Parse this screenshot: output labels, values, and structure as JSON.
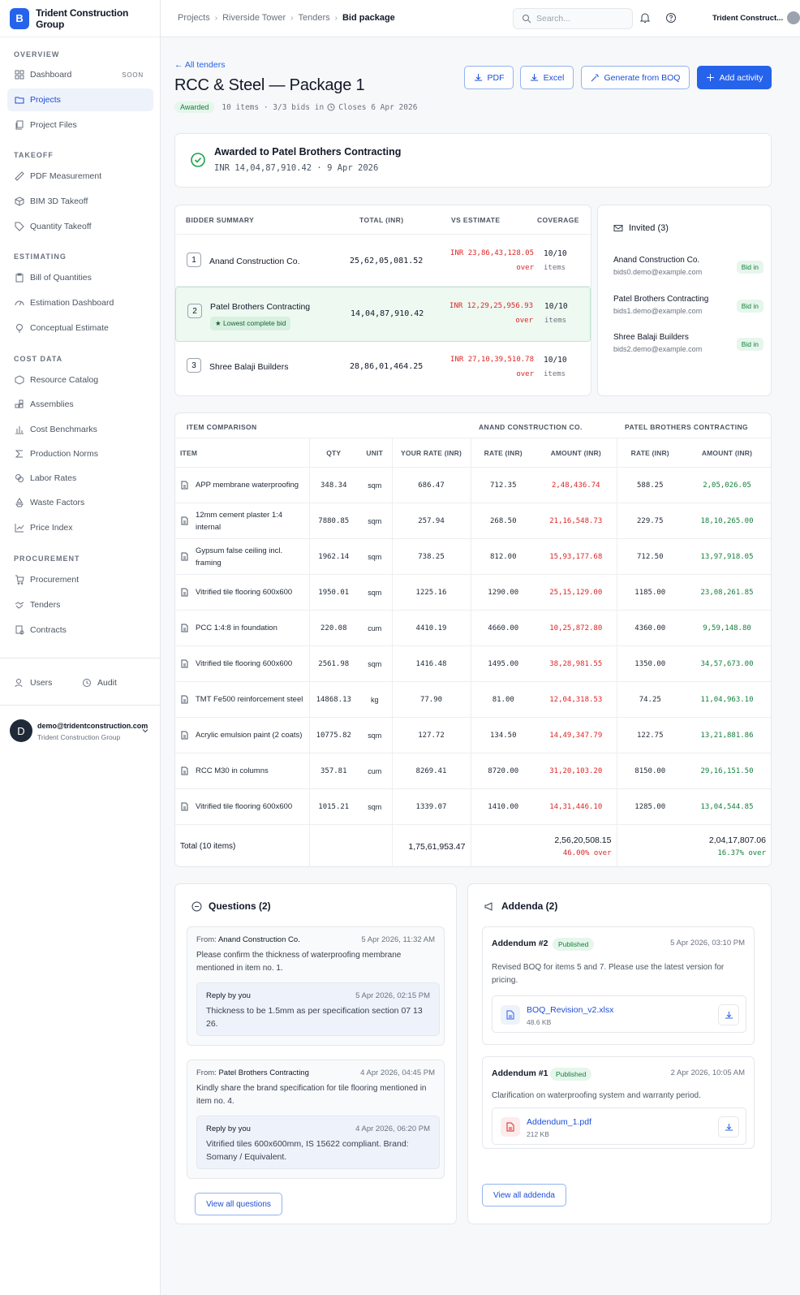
{
  "app": {
    "org": "Trident Construction Group",
    "logo_letter": "B"
  },
  "sidebar": {
    "sections": [
      "OVERVIEW",
      "TAKEOFF",
      "ESTIMATING",
      "COST DATA",
      "PROCUREMENT"
    ],
    "items": [
      {
        "label": "Dashboard",
        "icon": "grid-icon",
        "badge": "SOON"
      },
      {
        "label": "Projects",
        "icon": "folder-icon",
        "active": true
      },
      {
        "label": "Project Files",
        "icon": "files-icon"
      },
      {
        "label": "PDF Measurement",
        "icon": "ruler-icon"
      },
      {
        "label": "BIM 3D Takeoff",
        "icon": "cube-icon"
      },
      {
        "label": "Quantity Takeoff",
        "icon": "tag-icon"
      },
      {
        "label": "Bill of Quantities",
        "icon": "clipboard-icon"
      },
      {
        "label": "Estimation Dashboard",
        "icon": "gauge-icon"
      },
      {
        "label": "Conceptual Estimate",
        "icon": "bulb-icon"
      },
      {
        "label": "Resource Catalog",
        "icon": "box-icon"
      },
      {
        "label": "Assemblies",
        "icon": "blocks-icon"
      },
      {
        "label": "Cost Benchmarks",
        "icon": "bar-chart-icon"
      },
      {
        "label": "Production Norms",
        "icon": "sigma-icon"
      },
      {
        "label": "Labor Rates",
        "icon": "coins-icon"
      },
      {
        "label": "Waste Factors",
        "icon": "recycle-icon"
      },
      {
        "label": "Price Index",
        "icon": "line-chart-icon"
      },
      {
        "label": "Procurement",
        "icon": "cart-icon"
      },
      {
        "label": "Tenders",
        "icon": "handshake-icon"
      },
      {
        "label": "Contracts",
        "icon": "contract-icon"
      }
    ],
    "users": "Users",
    "audit": "Audit",
    "account": {
      "avatar": "D",
      "email": "demo@tridentconstruction.com",
      "org": "Trident Construction Group"
    }
  },
  "topbar": {
    "crumbs": [
      "Projects",
      "Riverside Tower",
      "Tenders",
      "Bid package"
    ],
    "search_placeholder": "Search...",
    "org_short": "Trident Construct..."
  },
  "header": {
    "back": "← All tenders",
    "title": "RCC & Steel — Package 1",
    "status": "Awarded",
    "meta": "10 items · 3/3 bids in",
    "closes": "Closes 6 Apr 2026",
    "buttons": {
      "pdf": "PDF",
      "excel": "Excel",
      "boq": "Generate from BOQ",
      "add": "Add activity"
    }
  },
  "award": {
    "title": "Awarded to Patel Brothers Contracting",
    "sub": "INR 14,04,87,910.42 · 9 Apr 2026"
  },
  "bidders": {
    "headers": [
      "BIDDER SUMMARY",
      "TOTAL (INR)",
      "VS ESTIMATE",
      "COVERAGE"
    ],
    "rows": [
      {
        "rank": "1",
        "name": "Anand Construction Co.",
        "total": "25,62,05,081.52",
        "vs": "INR 23,86,43,128.05",
        "vs2": "over",
        "cov": "10/10",
        "cov2": "items"
      },
      {
        "rank": "2",
        "name": "Patel Brothers Contracting",
        "tag": "Lowest complete bid",
        "total": "14,04,87,910.42",
        "vs": "INR 12,29,25,956.93",
        "vs2": "over",
        "cov": "10/10",
        "cov2": "items"
      },
      {
        "rank": "3",
        "name": "Shree Balaji Builders",
        "total": "28,86,01,464.25",
        "vs": "INR 27,10,39,510.78",
        "vs2": "over",
        "cov": "10/10",
        "cov2": "items"
      }
    ]
  },
  "invited": {
    "title": "Invited (3)",
    "items": [
      {
        "name": "Anand Construction Co.",
        "email": "bids0.demo@example.com",
        "status": "Bid in"
      },
      {
        "name": "Patel Brothers Contracting",
        "email": "bids1.demo@example.com",
        "status": "Bid in"
      },
      {
        "name": "Shree Balaji Builders",
        "email": "bids2.demo@example.com",
        "status": "Bid in"
      }
    ]
  },
  "comparison": {
    "title": "ITEM COMPARISON",
    "group1": "ANAND CONSTRUCTION CO.",
    "group2": "PATEL BROTHERS CONTRACTING",
    "headers": [
      "ITEM",
      "QTY",
      "UNIT",
      "YOUR RATE (INR)",
      "RATE (INR)",
      "AMOUNT (INR)",
      "RATE (INR)",
      "AMOUNT (INR)"
    ],
    "rows": [
      [
        "APP membrane waterproofing",
        "348.34",
        "sqm",
        "686.47",
        "712.35",
        "2,48,436.74",
        "588.25",
        "2,05,026.05"
      ],
      [
        "12mm cement plaster 1:4 internal",
        "7880.85",
        "sqm",
        "257.94",
        "268.50",
        "21,16,548.73",
        "229.75",
        "18,10,265.00"
      ],
      [
        "Gypsum false ceiling incl. framing",
        "1962.14",
        "sqm",
        "738.25",
        "812.00",
        "15,93,177.68",
        "712.50",
        "13,97,918.05"
      ],
      [
        "Vitrified tile flooring 600x600",
        "1950.01",
        "sqm",
        "1225.16",
        "1290.00",
        "25,15,129.00",
        "1185.00",
        "23,08,261.85"
      ],
      [
        "PCC 1:4:8 in foundation",
        "220.08",
        "cum",
        "4410.19",
        "4660.00",
        "10,25,872.80",
        "4360.00",
        "9,59,148.80"
      ],
      [
        "Vitrified tile flooring 600x600",
        "2561.98",
        "sqm",
        "1416.48",
        "1495.00",
        "38,28,981.55",
        "1350.00",
        "34,57,673.00"
      ],
      [
        "TMT Fe500 reinforcement steel",
        "14868.13",
        "kg",
        "77.90",
        "81.00",
        "12,04,318.53",
        "74.25",
        "11,04,963.10"
      ],
      [
        "Acrylic emulsion paint (2 coats)",
        "10775.82",
        "sqm",
        "127.72",
        "134.50",
        "14,49,347.79",
        "122.75",
        "13,21,881.86"
      ],
      [
        "RCC M30 in columns",
        "357.81",
        "cum",
        "8269.41",
        "8720.00",
        "31,20,103.20",
        "8150.00",
        "29,16,151.50"
      ],
      [
        "Vitrified tile flooring 600x600",
        "1015.21",
        "sqm",
        "1339.07",
        "1410.00",
        "14,31,446.10",
        "1285.00",
        "13,04,544.85"
      ]
    ],
    "total": {
      "label": "Total (10 items)",
      "your": "1,75,61,953.47",
      "a_amt": "2,56,20,508.15",
      "a_pct": "46.00% over",
      "p_amt": "2,04,17,807.06",
      "p_pct": "16.37% over"
    }
  },
  "questions": {
    "title": "Questions (2)",
    "items": [
      {
        "from": "Anand Construction Co.",
        "date": "5 Apr 2026, 11:32 AM",
        "text": "Please confirm the thickness of waterproofing membrane mentioned in item no. 1.",
        "reply_label": "Reply by you",
        "reply_date": "5 Apr 2026, 02:15 PM",
        "reply": "Thickness to be 1.5mm as per specification section 07 13 26."
      },
      {
        "from": "Patel Brothers Contracting",
        "date": "4 Apr 2026, 04:45 PM",
        "text": "Kindly share the brand specification for tile flooring mentioned in item no. 4.",
        "reply_label": "Reply by you",
        "reply_date": "4 Apr 2026, 06:20 PM",
        "reply": "Vitrified tiles 600x600mm, IS 15622 compliant. Brand: Somany / Equivalent."
      }
    ],
    "view_all": "View all questions",
    "from_label": "From:"
  },
  "addenda": {
    "title": "Addenda (2)",
    "items": [
      {
        "title": "Addendum #2",
        "status": "Published",
        "date": "5 Apr 2026, 03:10 PM",
        "text": "Revised BOQ for items 5 and 7. Please use the latest version for pricing.",
        "file": "BOQ_Revision_v2.xlsx",
        "size": "48.6 KB"
      },
      {
        "title": "Addendum #1",
        "status": "Published",
        "date": "2 Apr 2026, 10:05 AM",
        "text": "Clarification on waterproofing system and warranty period.",
        "file": "Addendum_1.pdf",
        "size": "212 KB"
      }
    ],
    "view_all": "View all addenda"
  }
}
